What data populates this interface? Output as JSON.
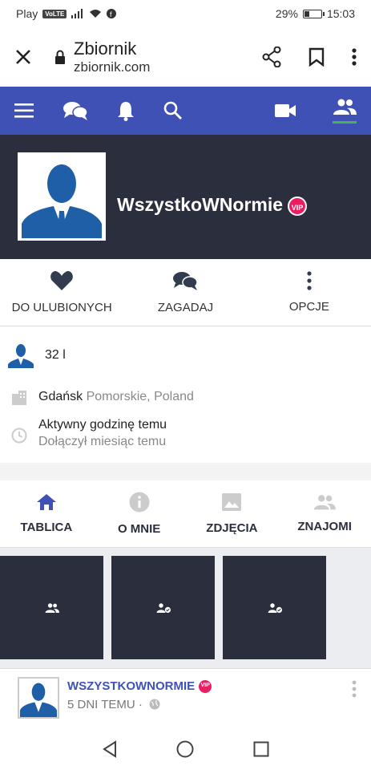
{
  "status_bar": {
    "carrier": "Play",
    "volte": "VoLTE",
    "battery_percent": "29%",
    "time": "15:03"
  },
  "browser": {
    "title": "Zbiornik",
    "url": "zbiornik.com"
  },
  "profile": {
    "username": "WszystkoWNormie",
    "vip_badge": "VIP"
  },
  "actions": [
    {
      "label": "DO ULUBIONYCH",
      "icon": "heart-icon"
    },
    {
      "label": "ZAGADAJ",
      "icon": "chat-icon"
    },
    {
      "label": "OPCJE",
      "icon": "more-vert-icon"
    }
  ],
  "info": {
    "age": "32 l",
    "city": "Gdańsk",
    "region": "Pomorskie, Poland",
    "active": "Aktywny godzinę temu",
    "joined": "Dołączył miesiąc temu"
  },
  "tabs": [
    {
      "label": "TABLICA",
      "icon": "home-icon"
    },
    {
      "label": "O MNIE",
      "icon": "info-icon"
    },
    {
      "label": "ZDJĘCIA",
      "icon": "image-icon"
    },
    {
      "label": "ZNAJOMI",
      "icon": "friends-icon"
    }
  ],
  "post": {
    "author": "WSZYSTKOWNORMIE",
    "vip_badge": "VIP",
    "time": "5 DNI TEMU ·"
  },
  "colors": {
    "nav_blue": "#3f51b5",
    "header_dark": "#2b2f3d",
    "vip_pink": "#e91e63",
    "active_green": "#4caf50"
  }
}
